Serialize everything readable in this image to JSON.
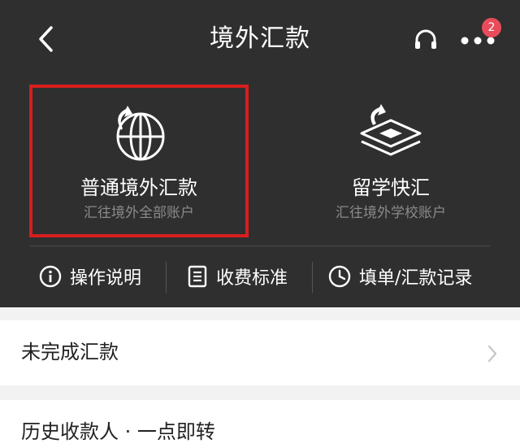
{
  "header": {
    "title": "境外汇款",
    "badge_count": "2",
    "back_icon": "chevron-left-icon",
    "service_icon": "headset-icon",
    "more_icon": "more-dots-icon"
  },
  "tiles": [
    {
      "title": "普通境外汇款",
      "subtitle": "汇往境外全部账户",
      "icon": "globe-arrow-icon"
    },
    {
      "title": "留学快汇",
      "subtitle": "汇往境外学校账户",
      "icon": "graduation-cap-icon"
    }
  ],
  "actions": [
    {
      "label": "操作说明",
      "icon": "info-icon"
    },
    {
      "label": "收费标准",
      "icon": "document-icon"
    },
    {
      "label": "填单/汇款记录",
      "icon": "clock-icon"
    }
  ],
  "list": [
    {
      "label": "未完成汇款"
    },
    {
      "label": "历史收款人 · 一点即转"
    }
  ],
  "colors": {
    "header_bg": "#2f2f2f",
    "highlight_border": "#d81e1e",
    "badge": "#e84c5a",
    "subtitle": "#8a8a8a"
  }
}
